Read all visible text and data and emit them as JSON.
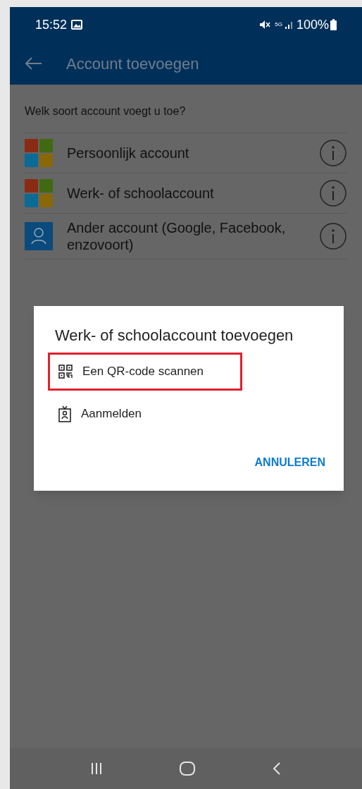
{
  "status_bar": {
    "time": "15:52",
    "network": "5G",
    "battery": "100%"
  },
  "toolbar": {
    "title": "Account toevoegen"
  },
  "prompt": "Welk soort account voegt u toe?",
  "accounts": [
    {
      "kind": "microsoft",
      "label": "Persoonlijk account"
    },
    {
      "kind": "microsoft",
      "label": "Werk- of schoolaccount"
    },
    {
      "kind": "person",
      "label": "Ander account (Google, Facebook, enzovoort)"
    }
  ],
  "dialog": {
    "title": "Werk- of schoolaccount toevoegen",
    "options": [
      {
        "kind": "qr",
        "label": "Een QR-code scannen",
        "highlighted": true
      },
      {
        "kind": "badge",
        "label": "Aanmelden",
        "highlighted": false
      }
    ],
    "cancel": "ANNULEREN"
  }
}
